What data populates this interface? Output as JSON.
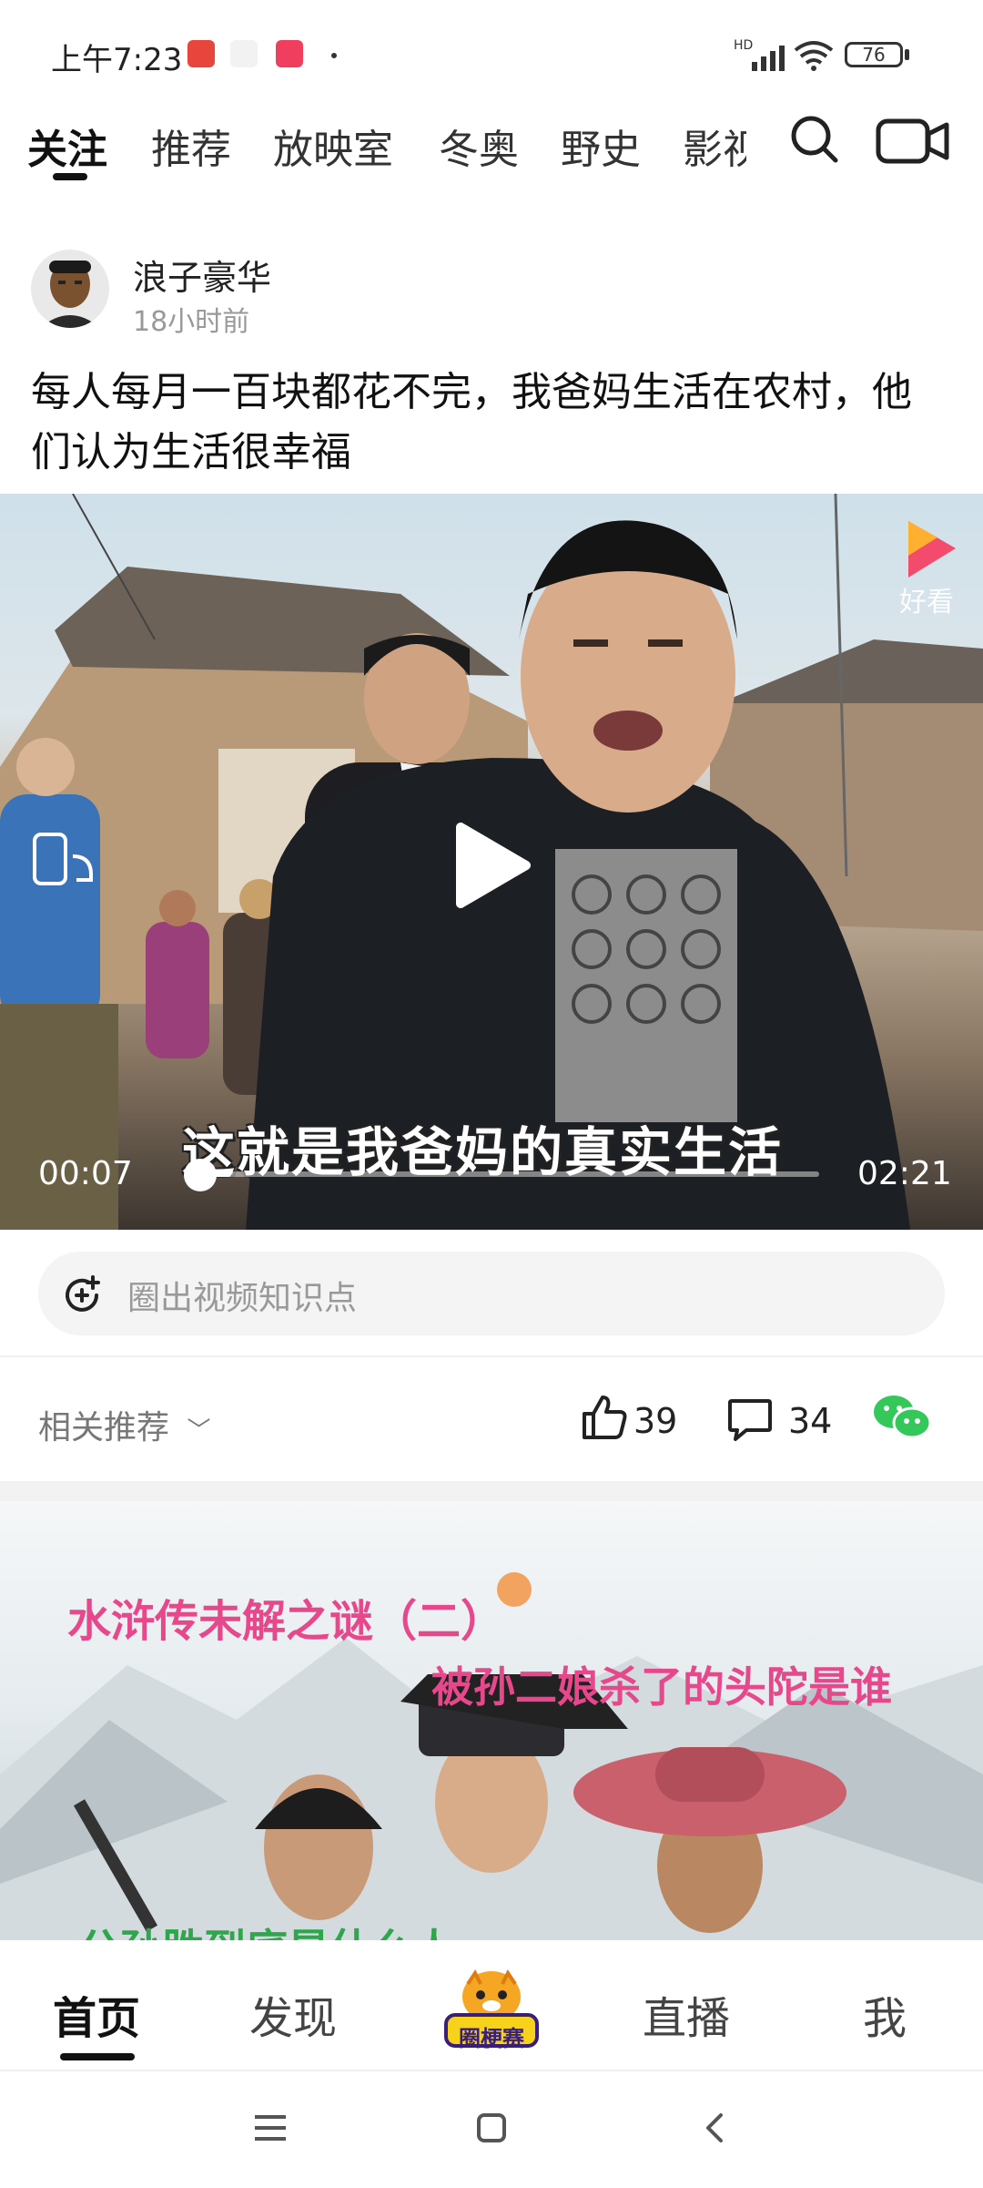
{
  "status_bar": {
    "time": "上午7:23",
    "battery": "76",
    "network": "HD"
  },
  "tabs": [
    {
      "label": "关注",
      "active": true
    },
    {
      "label": "推荐"
    },
    {
      "label": "放映室"
    },
    {
      "label": "冬奥"
    },
    {
      "label": "野史"
    },
    {
      "label": "影视"
    }
  ],
  "post": {
    "author": "浪子豪华",
    "time": "18小时前",
    "title": "每人每月一百块都花不完，我爸妈生活在农村，他们认为生活很幸福",
    "video": {
      "current_time": "00:07",
      "duration": "02:21",
      "progress": 0.05,
      "subtitle": "这就是我爸妈的真实生活",
      "watermark": "好看"
    },
    "knowledge_placeholder": "圈出视频知识点",
    "related_label": "相关推荐",
    "likes": "39",
    "comments": "34"
  },
  "next_card": {
    "title1": "水浒传未解之谜（二）",
    "title2": "被孙二娘杀了的头陀是谁",
    "bottom_text": "公孙胜到底是什么人"
  },
  "bottom_nav": [
    {
      "label": "首页",
      "active": true
    },
    {
      "label": "发现"
    },
    {
      "label": "圈梗赛",
      "center_badge": true
    },
    {
      "label": "直播"
    },
    {
      "label": "我"
    }
  ],
  "colors": {
    "accent": "#111111",
    "wechat": "#34c759",
    "card_title": "#e6488b"
  }
}
